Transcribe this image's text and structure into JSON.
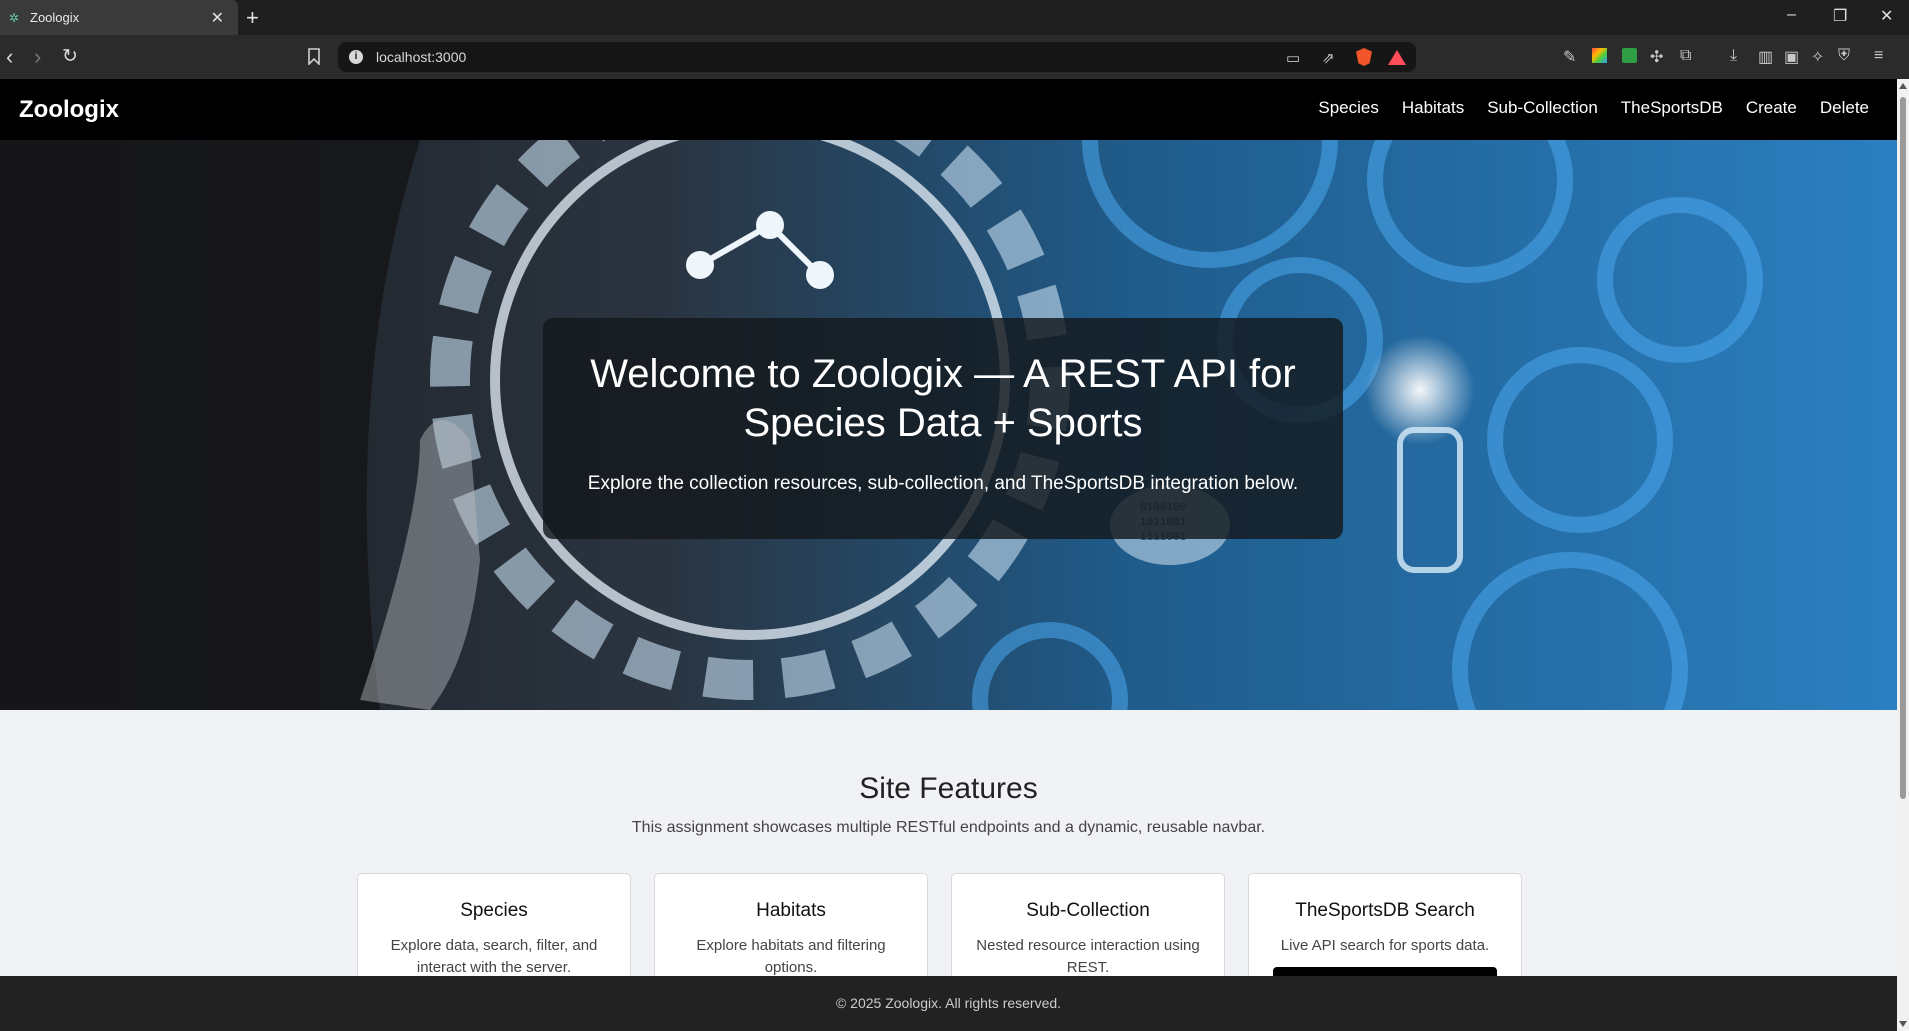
{
  "browser": {
    "tab_title": "Zoologix",
    "favicon": "paw-icon",
    "new_tab": "+",
    "url": "localhost:3000",
    "window_controls": [
      "–",
      "❐",
      "✕"
    ]
  },
  "site": {
    "brand": "Zoologix",
    "nav": [
      {
        "label": "Species"
      },
      {
        "label": "Habitats"
      },
      {
        "label": "Sub-Collection"
      },
      {
        "label": "TheSportsDB"
      },
      {
        "label": "Create"
      },
      {
        "label": "Delete"
      }
    ]
  },
  "hero": {
    "title": "Welcome to Zoologix — A REST API for Species Data + Sports",
    "subtitle": "Explore the collection resources, sub-collection, and TheSportsDB integration below.",
    "cloud_digits": [
      "0100100",
      "1011001",
      "1111001"
    ]
  },
  "features": {
    "title": "Site Features",
    "subtitle": "This assignment showcases multiple RESTful endpoints and a dynamic, reusable navbar.",
    "cards": [
      {
        "title": "Species",
        "text": "Explore data, search, filter, and interact with the server."
      },
      {
        "title": "Habitats",
        "text": "Explore habitats and filtering options."
      },
      {
        "title": "Sub-Collection",
        "text": "Nested resource interaction using REST."
      },
      {
        "title": "TheSportsDB Search",
        "text": "Live API search for sports data."
      }
    ]
  },
  "footer": {
    "text": "© 2025 Zoologix. All rights reserved."
  },
  "colors": {
    "nav_bg": "#000000",
    "page_bg": "#f1f2f6",
    "footer_bg": "#222222",
    "hero_blue": "#1e78c8"
  }
}
